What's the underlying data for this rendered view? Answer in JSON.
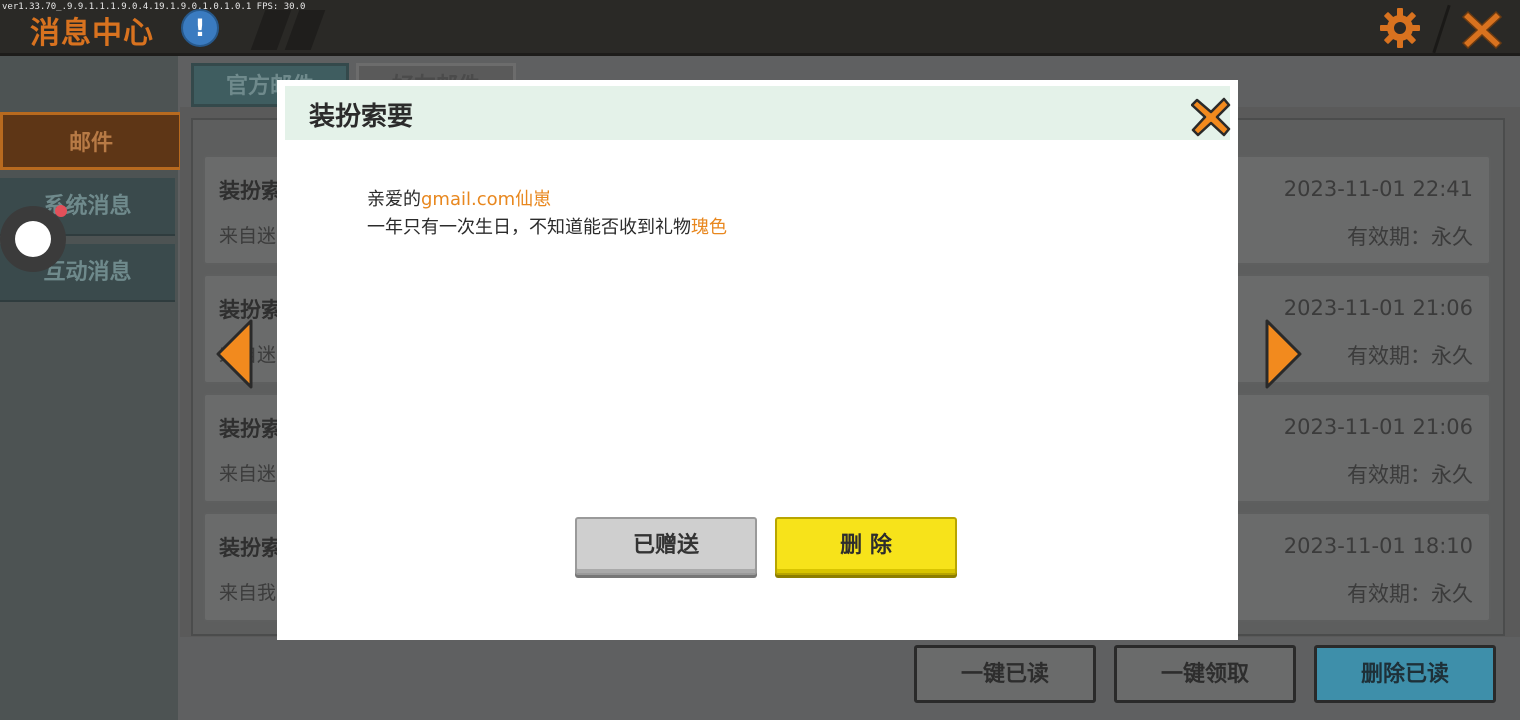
{
  "app": {
    "title": "消息中心",
    "debug_text": "ver1.33.70_.9.9.1.1.1.9.0.4.19.1.9.0.1.0.1.0.1 FPS: 30.0",
    "info_icon": "!",
    "settings_icon": "gear-icon",
    "close_icon": "close-icon"
  },
  "sidebar": {
    "items": [
      {
        "label": "邮件",
        "active": true
      },
      {
        "label": "系统消息",
        "active": false,
        "notification": true
      },
      {
        "label": "互动消息",
        "active": false
      }
    ]
  },
  "tabs": [
    {
      "label": "官方邮件",
      "active": true
    },
    {
      "label": "好友邮件",
      "active": false
    }
  ],
  "mail_list": [
    {
      "title": "装扮索",
      "from": "来自迷",
      "date": "2023-11-01 22:41",
      "validity": "有效期：永久"
    },
    {
      "title": "装扮索",
      "from": "来自迷",
      "date": "2023-11-01 21:06",
      "validity": "有效期：永久"
    },
    {
      "title": "装扮索",
      "from": "来自迷",
      "date": "2023-11-01 21:06",
      "validity": "有效期：永久"
    },
    {
      "title": "装扮索",
      "from": "来自我",
      "date": "2023-11-01 18:10",
      "validity": "有效期：永久"
    }
  ],
  "bottom_buttons": {
    "mark_all_read": "一键已读",
    "claim_all": "一键领取",
    "delete_read": "删除已读"
  },
  "modal": {
    "title": "装扮索要",
    "line1_prefix": "亲爱的",
    "line1_name": "gmail.com仙崽",
    "line2_text": "一年只有一次生日，不知道能否收到礼物",
    "line2_item": "瑰色",
    "gifted_button": "已赠送",
    "delete_button": "删 除"
  },
  "colors": {
    "accent_orange": "#e8871e",
    "delete_yellow": "#f7e31a",
    "header_green": "#e4f2e9",
    "blue_button": "#3e8faa"
  }
}
